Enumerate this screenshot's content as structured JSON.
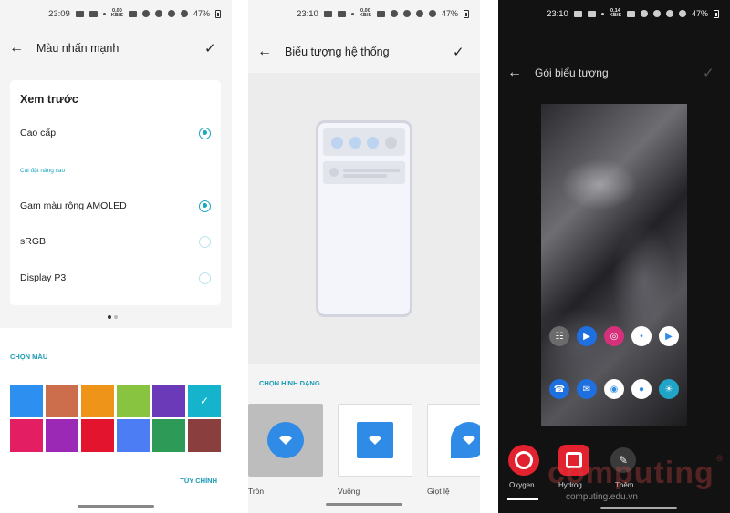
{
  "colors": {
    "accent": "#1aa7bf",
    "accent_label": "#1a9ab3",
    "icon_blue": "#2f8be6"
  },
  "screen1": {
    "status": {
      "time": "23:09",
      "signal_text": "0,00\nKB/S",
      "battery": "47%"
    },
    "header": {
      "title": "Màu nhấn mạnh"
    },
    "card": {
      "heading": "Xem trước",
      "option_top": {
        "label": "Cao cấp",
        "selected": true
      },
      "subsection": "Cài đặt nâng cao",
      "options": [
        {
          "label": "Gam màu rộng AMOLED",
          "selected": true
        },
        {
          "label": "sRGB",
          "selected": false
        },
        {
          "label": "Display P3",
          "selected": false
        }
      ]
    },
    "pager": {
      "pages": 2,
      "current": 1
    },
    "color_section": "CHỌN MÀU",
    "swatches": [
      "#2d8ff0",
      "#cc6e4c",
      "#ee9418",
      "#88c440",
      "#6a3ab8",
      "#16b3cd",
      "#e41e63",
      "#9b29b6",
      "#e3142d",
      "#4d7df5",
      "#2e9a58",
      "#8b3e3e"
    ],
    "selected_swatch": 5,
    "custom_button": "TÙY CHỈNH"
  },
  "screen2": {
    "status": {
      "time": "23:10",
      "signal_text": "0,00\nKB/S",
      "battery": "47%"
    },
    "header": {
      "title": "Biểu tượng hệ thống"
    },
    "quick_dots": [
      "#bcd4f0",
      "#bcd4f0",
      "#bcd4f0",
      "#d0d3dc"
    ],
    "shape_section": "CHỌN HÌNH DẠNG",
    "shapes": [
      {
        "label": "Tròn",
        "kind": "circle",
        "selected": true
      },
      {
        "label": "Vuông",
        "kind": "square",
        "selected": false
      },
      {
        "label": "Giọt lệ",
        "kind": "teardrop",
        "selected": false
      }
    ]
  },
  "screen3": {
    "status": {
      "time": "23:10",
      "signal_text": "0,14\nKB/S",
      "battery": "47%"
    },
    "header": {
      "title": "Gói biểu tượng"
    },
    "apps_row1": [
      {
        "icon": "apps-grid-icon",
        "bg": "#6b6b6b"
      },
      {
        "icon": "video-call-icon",
        "bg": "#1e6fe0"
      },
      {
        "icon": "instagram-icon",
        "bg": "#d6307a"
      },
      {
        "icon": "assistant-icon",
        "bg": "#ffffff"
      },
      {
        "icon": "play-store-icon",
        "bg": "#ffffff"
      }
    ],
    "apps_row2": [
      {
        "icon": "phone-icon",
        "bg": "#1e6fe0"
      },
      {
        "icon": "messages-icon",
        "bg": "#1e6fe0"
      },
      {
        "icon": "chrome-icon",
        "bg": "#ffffff"
      },
      {
        "icon": "camera-icon",
        "bg": "#ffffff"
      },
      {
        "icon": "weather-icon",
        "bg": "#20a4c8"
      }
    ],
    "packs": [
      {
        "label": "Oxygen",
        "kind": "ring"
      },
      {
        "label": "Hydrog...",
        "kind": "square"
      },
      {
        "label": "Thêm",
        "kind": "more"
      }
    ],
    "watermark": {
      "brand": "computing",
      "site": "computing.edu.vn",
      "reg": "®"
    }
  }
}
